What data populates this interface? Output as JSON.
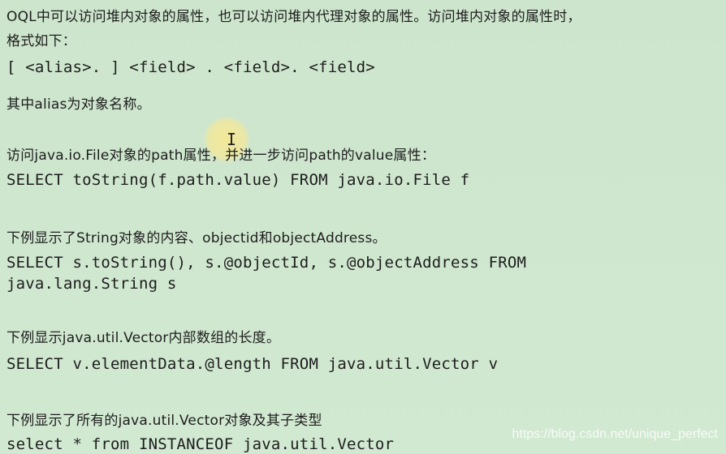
{
  "lines": {
    "l1": "OQL中可以访问堆内对象的属性，也可以访问堆内代理对象的属性。访问堆内对象的属性时，",
    "l2": "格式如下：",
    "l3": "[ <alias>. ] <field> . <field>. <field>",
    "l4": "其中alias为对象名称。",
    "l5": "访问java.io.File对象的path属性，并进一步访问path的value属性：",
    "l6": "SELECT toString(f.path.value) FROM java.io.File f",
    "l7": "下例显示了String对象的内容、objectid和objectAddress。",
    "l8": "SELECT s.toString(), s.@objectId, s.@objectAddress FROM",
    "l9": "java.lang.String s",
    "l10": "下例显示java.util.Vector内部数组的长度。",
    "l11": "SELECT v.elementData.@length FROM java.util.Vector v",
    "l12": "下例显示了所有的java.util.Vector对象及其子类型",
    "l13": "select * from INSTANCEOF java.util.Vector"
  },
  "watermark": "https://blog.csdn.net/unique_perfect",
  "colors": {
    "background": "#cfe6cf",
    "text": "#1d1d1d",
    "cursor_highlight": "#f6e896"
  }
}
